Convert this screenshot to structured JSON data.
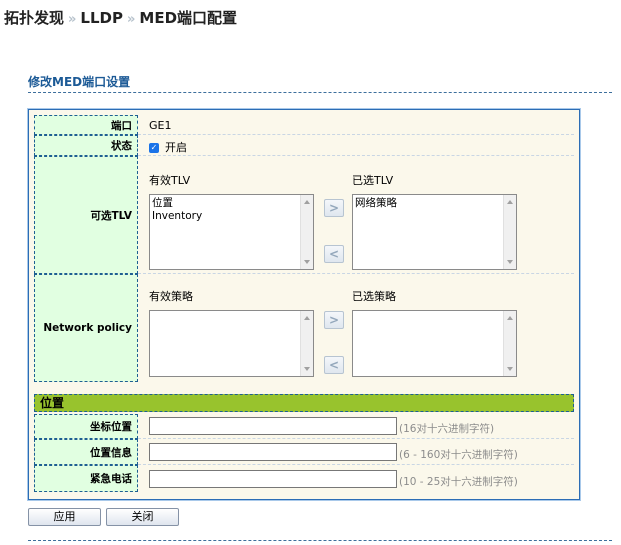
{
  "breadcrumb": {
    "level1": "拓扑发现",
    "level2": "LLDP",
    "level3": "MED端口配置",
    "separator": "»"
  },
  "section": {
    "title": "修改MED端口设置"
  },
  "form": {
    "port": {
      "label": "端口",
      "value": "GE1"
    },
    "status": {
      "label": "状态",
      "checkbox_label": "开启",
      "checked": true
    },
    "tlv": {
      "label": "可选TLV",
      "available_label": "有效TLV",
      "available_items": [
        "位置",
        "Inventory"
      ],
      "selected_label": "已选TLV",
      "selected_items": [
        "网络策略"
      ],
      "move_right": ">",
      "move_left": "<"
    },
    "policy": {
      "label": "Network policy",
      "available_label": "有效策略",
      "selected_label": "已选策略",
      "move_right": ">",
      "move_left": "<"
    },
    "location": {
      "section_label": "位置",
      "coord": {
        "label": "坐标位置",
        "value": "",
        "hint": "(16对十六进制字符)"
      },
      "info": {
        "label": "位置信息",
        "value": "",
        "hint": "(6 - 160对十六进制字符)"
      },
      "emergency": {
        "label": "紧急电话",
        "value": "",
        "hint": "(10 - 25对十六进制字符)"
      }
    }
  },
  "buttons": {
    "apply": "应用",
    "close": "关闭"
  },
  "colors": {
    "label_bg": "#e1ffe1",
    "band_bg": "#98c32d",
    "panel_bg": "#fbf8eb",
    "title_blue": "#1c5a96"
  }
}
